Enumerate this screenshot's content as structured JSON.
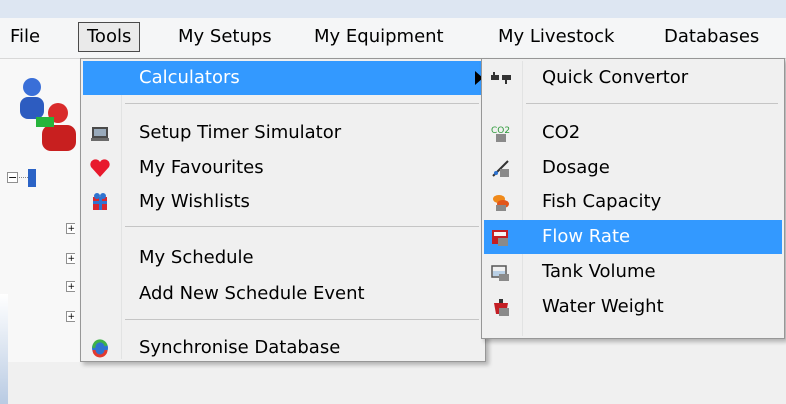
{
  "menubar": {
    "items": [
      {
        "label": "File"
      },
      {
        "label": "Tools"
      },
      {
        "label": "My Setups"
      },
      {
        "label": "My Equipment"
      },
      {
        "label": "My Livestock"
      },
      {
        "label": "Databases"
      }
    ]
  },
  "tools_menu": {
    "items": [
      {
        "label": "Calculators",
        "icon": "none",
        "highlighted": true,
        "has_submenu": true
      },
      {
        "label": "Setup Timer Simulator",
        "icon": "timer-simulator-icon"
      },
      {
        "label": "My Favourites",
        "icon": "heart-icon"
      },
      {
        "label": "My Wishlists",
        "icon": "wishlist-icon"
      },
      {
        "label": "My Schedule",
        "icon": "none"
      },
      {
        "label": "Add New Schedule Event",
        "icon": "none"
      },
      {
        "label": "Synchronise Database",
        "icon": "sync-icon"
      }
    ]
  },
  "calculators_submenu": {
    "items": [
      {
        "label": "Quick Convertor",
        "icon": "convertor-icon"
      },
      {
        "label": "CO2",
        "icon": "co2-icon"
      },
      {
        "label": "Dosage",
        "icon": "dosage-icon"
      },
      {
        "label": "Fish Capacity",
        "icon": "fish-capacity-icon"
      },
      {
        "label": "Flow Rate",
        "icon": "flow-rate-icon",
        "highlighted": true
      },
      {
        "label": "Tank Volume",
        "icon": "tank-volume-icon"
      },
      {
        "label": "Water Weight",
        "icon": "water-weight-icon"
      }
    ]
  },
  "colors": {
    "highlight": "#3399ff",
    "menu_bg": "#f0f0f0",
    "heart": "#e8192c"
  }
}
